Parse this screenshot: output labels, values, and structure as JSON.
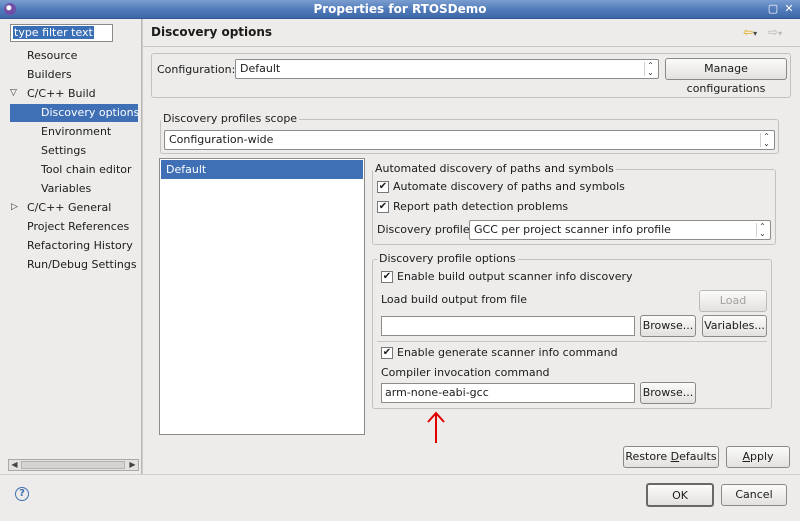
{
  "window": {
    "title": "Properties for RTOSDemo"
  },
  "filter": {
    "placeholder": "type filter text"
  },
  "tree": [
    {
      "label": "Resource"
    },
    {
      "label": "Builders"
    },
    {
      "label": "C/C++ Build"
    },
    {
      "label": "Discovery options"
    },
    {
      "label": "Environment"
    },
    {
      "label": "Settings"
    },
    {
      "label": "Tool chain editor"
    },
    {
      "label": "Variables"
    },
    {
      "label": "C/C++ General"
    },
    {
      "label": "Project References"
    },
    {
      "label": "Refactoring History"
    },
    {
      "label": "Run/Debug Settings"
    }
  ],
  "page": {
    "title": "Discovery options",
    "configuration_label": "Configuration:",
    "configuration_value": "Default",
    "manage_button": "Manage configurations",
    "scope_group": "Discovery profiles scope",
    "scope_value": "Configuration-wide",
    "profile_list": [
      "Default"
    ],
    "auto_group": "Automated discovery of paths and symbols",
    "auto_check": "Automate discovery of paths and symbols",
    "report_check": "Report path detection problems",
    "profile_label": "Discovery profile:",
    "profile_value": "GCC per project scanner info profile",
    "options_group": "Discovery profile options",
    "enable_build_check": "Enable build output scanner info discovery",
    "load_label": "Load build output from file",
    "load_button": "Load",
    "load_value": "",
    "browse1": "Browse...",
    "variables_button": "Variables...",
    "enable_generate_check": "Enable generate scanner info command",
    "compiler_label": "Compiler invocation command",
    "compiler_value": "arm-none-eabi-gcc",
    "browse2": "Browse...",
    "restore_prefix": "Restore ",
    "restore_underlined": "D",
    "restore_suffix": "efaults",
    "apply_underlined": "A",
    "apply_suffix": "pply"
  },
  "footer": {
    "ok": "OK",
    "cancel": "Cancel"
  },
  "colors": {
    "selection": "#3f6fb5",
    "annotation_arrow": "#e00000"
  }
}
